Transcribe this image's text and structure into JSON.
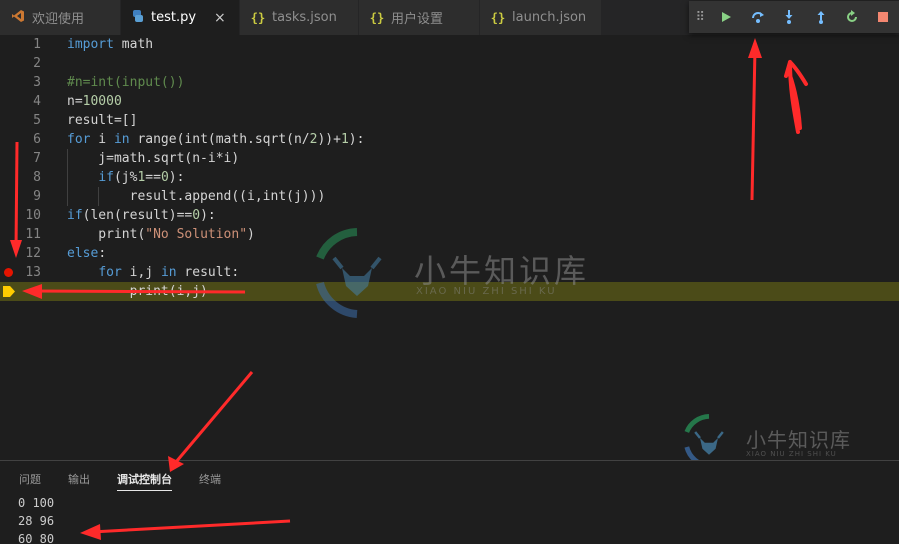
{
  "tabs": [
    {
      "label": "欢迎使用",
      "icon": "vscode-logo-icon"
    },
    {
      "label": "test.py",
      "icon": "python-icon",
      "active": true,
      "close": "×"
    },
    {
      "label": "tasks.json",
      "icon": "json-icon"
    },
    {
      "label": "用户设置",
      "icon": "json-icon"
    },
    {
      "label": "launch.json",
      "icon": "json-icon"
    }
  ],
  "json_icon_glyph": "{}",
  "debug_toolbar": {
    "buttons": [
      "continue-icon",
      "step-over-icon",
      "step-into-icon",
      "step-out-icon",
      "restart-icon",
      "stop-icon"
    ]
  },
  "editor": {
    "line_numbers": [
      "1",
      "2",
      "3",
      "4",
      "5",
      "6",
      "7",
      "8",
      "9",
      "10",
      "11",
      "12",
      "13",
      ""
    ],
    "current_line_index": 13,
    "breakpoint_line_index": 12,
    "code": {
      "l1_a": "import",
      "l1_b": " math",
      "l3": "#n=int(input())",
      "l4_a": "n=",
      "l4_b": "10000",
      "l5": "result=[]",
      "l6_a": "for",
      "l6_b": " i ",
      "l6_c": "in",
      "l6_d": " range(int(math.sqrt(n/",
      "l6_e": "2",
      "l6_f": "))+",
      "l6_g": "1",
      "l6_h": "):",
      "l7": "    j=math.sqrt(n-i*i)",
      "l8_a": "    ",
      "l8_b": "if",
      "l8_c": "(j%",
      "l8_d": "1",
      "l8_e": "==",
      "l8_f": "0",
      "l8_g": "):",
      "l9": "        result.append((i,int(j)))",
      "l10_a": "if",
      "l10_b": "(len(result)==",
      "l10_c": "0",
      "l10_d": "):",
      "l11_a": "    print(",
      "l11_b": "\"No Solution\"",
      "l11_c": ")",
      "l12_a": "else",
      "l12_b": ":",
      "l13_a": "    ",
      "l13_b": "for",
      "l13_c": " i,j ",
      "l13_d": "in",
      "l13_e": " result:",
      "l14": "        print(i,j)"
    }
  },
  "panel": {
    "tabs": [
      "问题",
      "输出",
      "调试控制台",
      "终端"
    ],
    "active_tab": "调试控制台",
    "output_lines": [
      "0 100",
      "28 96",
      "60 80"
    ]
  },
  "watermark": {
    "text": "小牛知识库",
    "subtitle": "XIAO NIU ZHI SHI KU"
  },
  "colors": {
    "annotation_red": "#ff2a2a",
    "current_line_bg": "#4b4b18",
    "breakpoint": "#e51400",
    "debug_continue": "#89d185",
    "debug_step": "#75beff",
    "debug_stop": "#f48771"
  }
}
